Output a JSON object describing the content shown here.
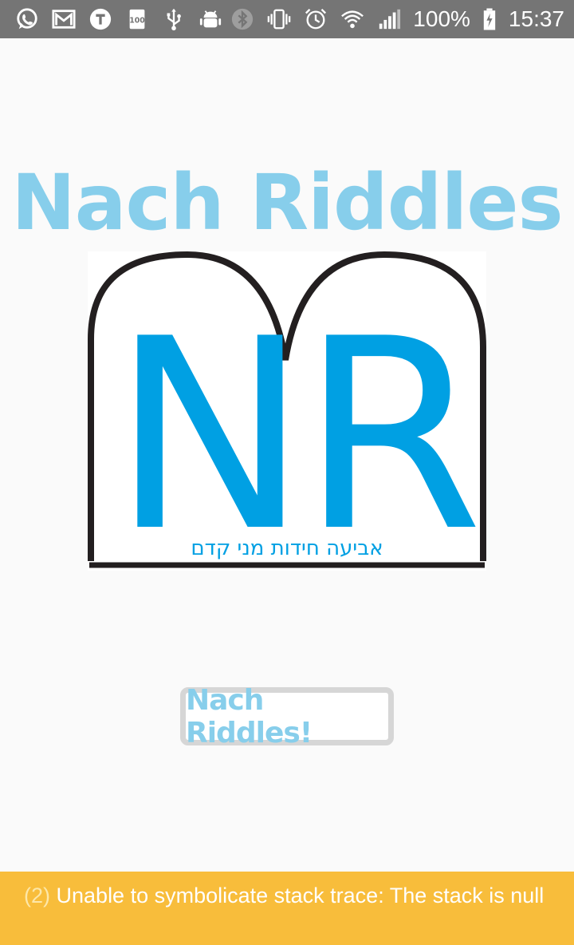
{
  "status_bar": {
    "left_icons": [
      "whatsapp-icon",
      "gmail-icon",
      "telegram-icon",
      "storage-100-icon",
      "usb-icon",
      "android-debug-icon"
    ],
    "right_icons": [
      "bluetooth-icon",
      "vibrate-icon",
      "alarm-icon",
      "wifi-icon",
      "signal-icon",
      "battery-charging-icon"
    ],
    "battery_percent": "100%",
    "time": "15:37"
  },
  "app": {
    "title": "Nach Riddles",
    "logo": {
      "letters": "NR",
      "hebrew_tagline": "אביעה חידות מני קדם",
      "letter_color": "#00a0e3",
      "frame_color": "#231f20"
    },
    "start_button_label": "Nach Riddles!"
  },
  "warning": {
    "count": "(2)",
    "message": "Unable to symbolicate stack trace: The stack is null"
  },
  "colors": {
    "title": "#87ceeb",
    "status_bar": "#757575",
    "banner": "#f8bd3b",
    "background": "#fafafa"
  }
}
